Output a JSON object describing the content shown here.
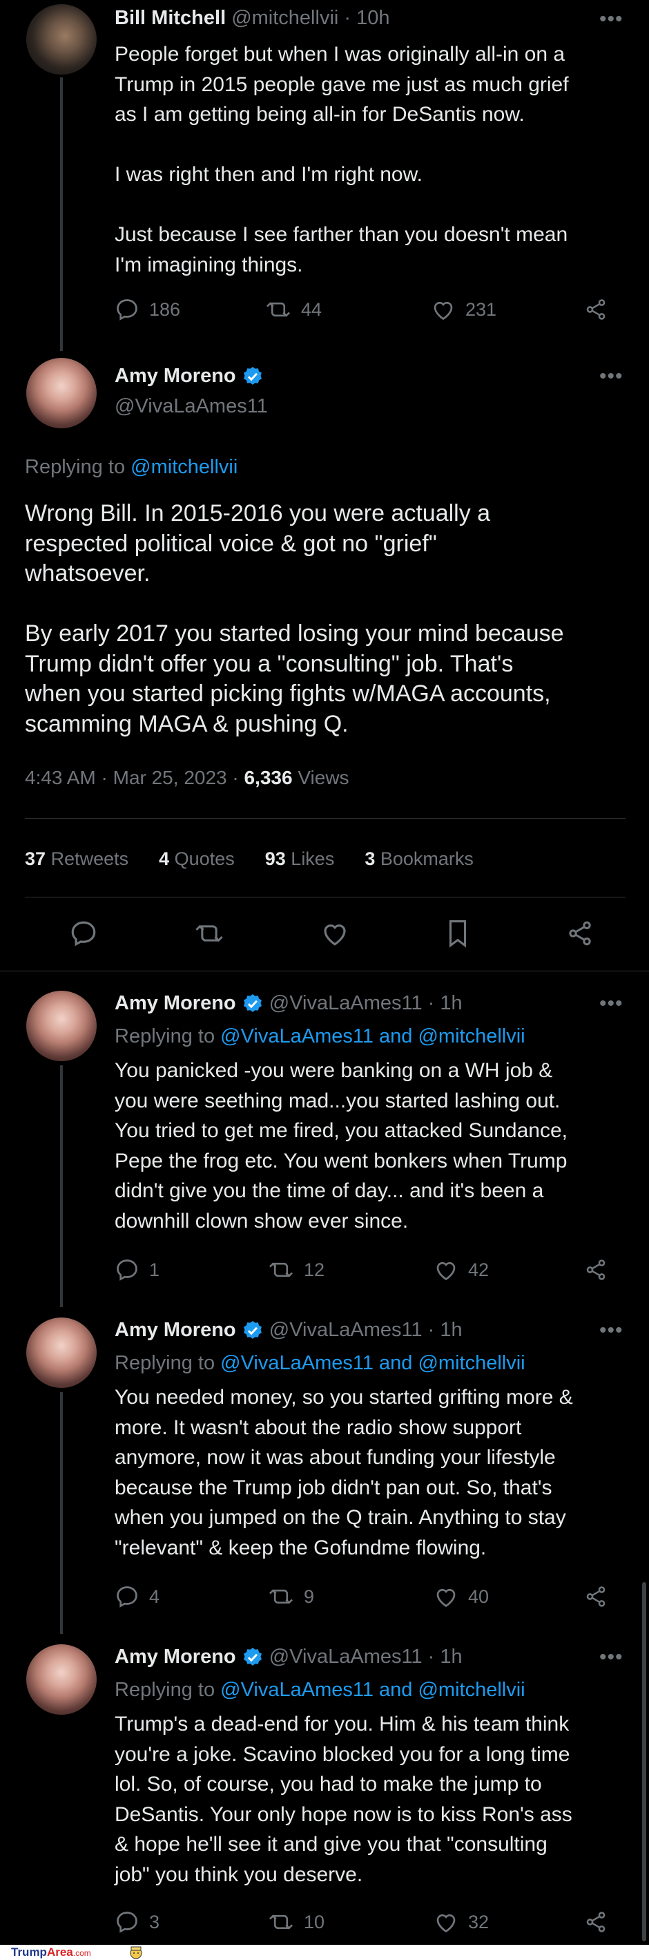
{
  "tweets": [
    {
      "name": "Bill Mitchell",
      "handle": "@mitchellvii",
      "time": "· 10h",
      "text": "People forget but when I was originally all-in on a\nTrump in 2015 people gave me just as much grief\nas I am getting being all-in for DeSantis now.\n\nI was right then and I'm right now.\n\nJust because I see farther than you doesn't mean\nI'm imagining things.",
      "replies": "186",
      "retweets": "44",
      "likes": "231"
    },
    {
      "name": "Amy Moreno",
      "handle": "@VivaLaAmes11",
      "replying_prefix": "Replying to",
      "replying_to": "@mitchellvii",
      "text": "Wrong Bill. In 2015-2016 you were actually a\nrespected political voice & got no \"grief\"\nwhatsoever.\n\nBy early 2017 you started losing your mind because\nTrump didn't offer you a \"consulting\" job. That's\nwhen you started picking fights w/MAGA accounts,\nscamming MAGA & pushing Q.",
      "timestamp": "4:43 AM · Mar 25, 2023 ·",
      "views_count": "6,336",
      "views_label": "Views",
      "stats": [
        {
          "count": "37",
          "label": "Retweets"
        },
        {
          "count": "4",
          "label": "Quotes"
        },
        {
          "count": "93",
          "label": "Likes"
        },
        {
          "count": "3",
          "label": "Bookmarks"
        }
      ]
    },
    {
      "name": "Amy Moreno",
      "handle": "@VivaLaAmes11",
      "time": "· 1h",
      "replying_prefix": "Replying to",
      "replying_to": "@VivaLaAmes11 and @mitchellvii",
      "text": "You panicked -you were banking on a WH job &\nyou were seething mad...you started lashing out.\nYou tried to get me fired, you attacked Sundance,\nPepe the frog etc. You went bonkers when Trump\ndidn't give you the time of day... and it's been a\ndownhill clown show ever since.",
      "replies": "1",
      "retweets": "12",
      "likes": "42"
    },
    {
      "name": "Amy Moreno",
      "handle": "@VivaLaAmes11",
      "time": "· 1h",
      "replying_prefix": "Replying to",
      "replying_to": "@VivaLaAmes11 and @mitchellvii",
      "text": "You needed money, so you started grifting more &\nmore. It wasn't about the radio show support\nanymore, now it was about funding your lifestyle\nbecause the Trump job didn't pan out. So, that's\nwhen you jumped on the Q train. Anything to stay\n\"relevant\" & keep the Gofundme flowing.",
      "replies": "4",
      "retweets": "9",
      "likes": "40"
    },
    {
      "name": "Amy Moreno",
      "handle": "@VivaLaAmes11",
      "time": "· 1h",
      "replying_prefix": "Replying to",
      "replying_to": "@VivaLaAmes11 and @mitchellvii",
      "text": "Trump's a dead-end for you. Him & his team think\nyou're a joke. Scavino blocked you for a long time\nlol. So, of course, you had to make the jump to\nDeSantis. Your only hope now is to kiss Ron's ass\n& hope he'll see it and give you that \"consulting\njob\" you think you deserve.",
      "replies": "3",
      "retweets": "10",
      "likes": "32"
    }
  ],
  "footer": {
    "logo_a": "Trump",
    "logo_b": "Area",
    "logo_c": ".com"
  },
  "colors": {
    "background": "#000000",
    "text": "#e7e9ea",
    "muted": "#71767b",
    "link": "#1d9bf0",
    "verified": "#1d9bf0"
  }
}
